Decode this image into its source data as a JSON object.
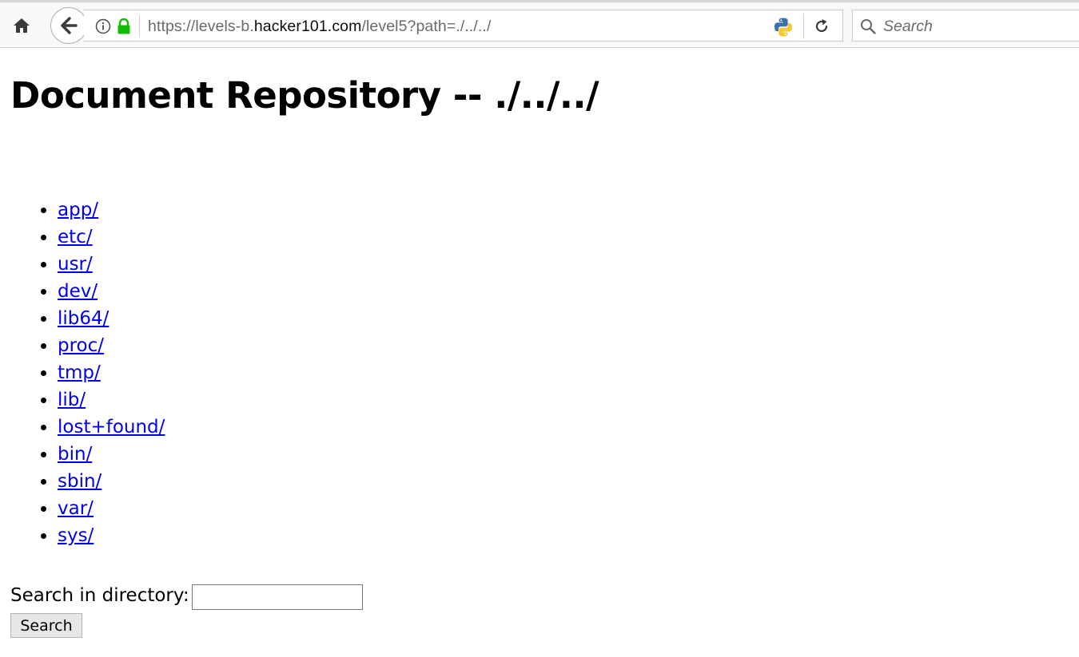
{
  "browser": {
    "url_scheme": "https://levels-b.",
    "url_host": "hacker101.com",
    "url_path": "/level5?path=./../../",
    "search_placeholder": "Search"
  },
  "page": {
    "title": "Document Repository -- ./../../",
    "directories": [
      "app/",
      "etc/",
      "usr/",
      "dev/",
      "lib64/",
      "proc/",
      "tmp/",
      "lib/",
      "lost+found/",
      "bin/",
      "sbin/",
      "var/",
      "sys/"
    ],
    "search_label": "Search in directory:",
    "search_value": "",
    "search_button": "Search"
  },
  "colors": {
    "link": "#0000ee",
    "toolbar_bg": "#f9f9fa",
    "lock_green": "#12bc00"
  }
}
